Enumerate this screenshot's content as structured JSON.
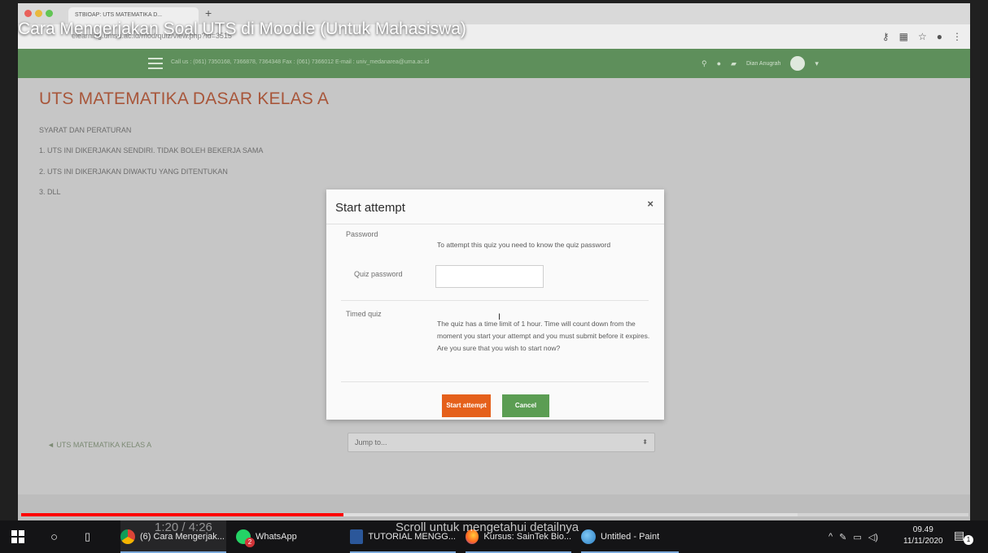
{
  "video": {
    "title": "Cara Mengerjakan Soal UTS di Moodle (Untuk Mahasiswa)",
    "time": "1:20 / 4:26",
    "scroll_hint": "Scroll untuk mengetahui detailnya",
    "progress_played": 0.34,
    "progress_buffered": 0.82
  },
  "browser": {
    "tab_title": "STBIOAP: UTS MATEMATIKA D...",
    "url": "elearning.umsu.ac.id/mod/quiz/view.php?id=3515"
  },
  "moodle": {
    "nav_contact": "Call us : (061) 7350168, 7366878, 7364348 Fax : (061) 7366012  E-mail : univ_medanarea@uma.ac.id",
    "user_name": "Dian Anugrah",
    "page_title": "UTS MATEMATIKA DASAR KELAS A",
    "rules": [
      "SYARAT DAN PERATURAN",
      "1. UTS INI DIKERJAKAN SENDIRI. TIDAK BOLEH BEKERJA SAMA",
      "2. UTS INI DIKERJAKAN DIWAKTU YANG DITENTUKAN",
      "3. DLL"
    ],
    "prev_link": "◄ UTS MATEMATIKA KELAS A",
    "jump_to": "Jump to...",
    "jump_arrow": "⬍"
  },
  "modal": {
    "title": "Start attempt",
    "close": "×",
    "password_label": "Password",
    "password_text": "To attempt this quiz you need to know the quiz password",
    "quiz_password_label": "Quiz password",
    "timed_label": "Timed quiz",
    "timed_text": "The quiz has a time limit of 1 hour. Time will count down from the moment you start your attempt and you must submit before it expires. Are you sure that you wish to start now?",
    "start_button": "Start attempt",
    "cancel_button": "Cancel"
  },
  "taskbar": {
    "items": [
      {
        "label": "(6) Cara Mengerjak...",
        "icon": "chrome-icon"
      },
      {
        "label": "WhatsApp",
        "icon": "whatsapp-icon",
        "badge": "2"
      },
      {
        "label": "TUTORIAL MENGG...",
        "icon": "word-icon"
      },
      {
        "label": "Kursus: SainTek Bio...",
        "icon": "firefox-icon"
      },
      {
        "label": "Untitled - Paint",
        "icon": "paint-icon"
      }
    ],
    "time": "09.49",
    "date": "11/11/2020",
    "notification_count": "1"
  },
  "colors": {
    "moodle_green": "#5e8f5b",
    "title_orange": "#a8563a",
    "start_orange": "#e5601b",
    "cancel_green": "#5b9d53",
    "progress_red": "#ff0000"
  }
}
